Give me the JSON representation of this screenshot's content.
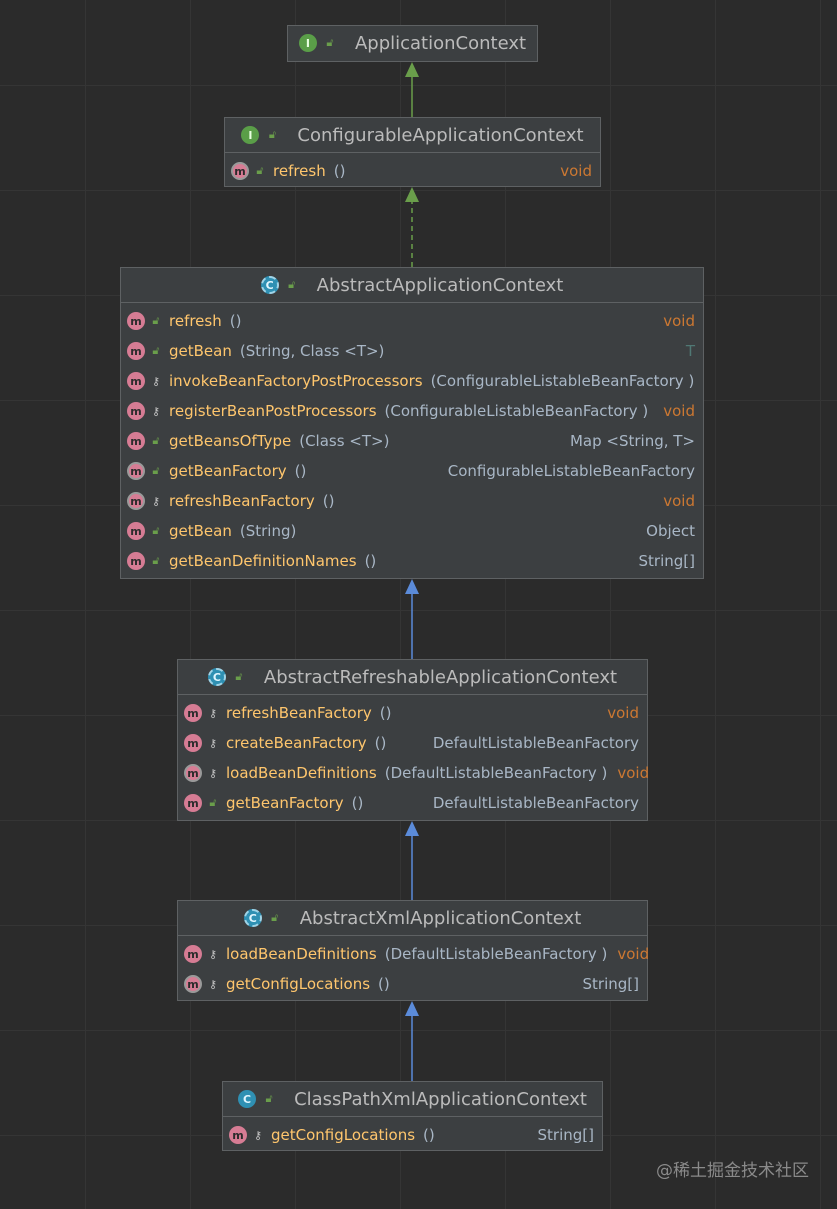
{
  "classes": [
    {
      "name": "ApplicationContext",
      "kind": "I",
      "members": []
    },
    {
      "name": "ConfigurableApplicationContext",
      "kind": "I",
      "members": [
        {
          "name": "refresh",
          "params": "()",
          "ret": "void",
          "ret_style": "kw",
          "vis": "public",
          "abstract": true
        }
      ]
    },
    {
      "name": "AbstractApplicationContext",
      "kind": "C",
      "abstract": true,
      "members": [
        {
          "name": "refresh",
          "params": "()",
          "ret": "void",
          "ret_style": "kw",
          "vis": "public",
          "abstract": false
        },
        {
          "name": "getBean",
          "params": "(String, Class <T>)",
          "ret": "T",
          "ret_style": "tp",
          "vis": "public",
          "abstract": false
        },
        {
          "name": "invokeBeanFactoryPostProcessors",
          "params": "(ConfigurableListableBeanFactory )",
          "ret": "",
          "ret_style": "",
          "vis": "protected",
          "abstract": false
        },
        {
          "name": "registerBeanPostProcessors",
          "params": "(ConfigurableListableBeanFactory )",
          "ret": "void",
          "ret_style": "kw",
          "vis": "protected",
          "abstract": false
        },
        {
          "name": "getBeansOfType",
          "params": "(Class <T>)",
          "ret": "Map <String, T>",
          "ret_style": "",
          "vis": "public",
          "abstract": false
        },
        {
          "name": "getBeanFactory",
          "params": "()",
          "ret": "ConfigurableListableBeanFactory",
          "ret_style": "",
          "vis": "public",
          "abstract": true
        },
        {
          "name": "refreshBeanFactory",
          "params": "()",
          "ret": "void",
          "ret_style": "kw",
          "vis": "protected",
          "abstract": true
        },
        {
          "name": "getBean",
          "params": "(String)",
          "ret": "Object",
          "ret_style": "",
          "vis": "public",
          "abstract": false
        },
        {
          "name": "getBeanDefinitionNames",
          "params": "()",
          "ret": "String[]",
          "ret_style": "",
          "vis": "public",
          "abstract": false
        }
      ]
    },
    {
      "name": "AbstractRefreshableApplicationContext",
      "kind": "C",
      "abstract": true,
      "members": [
        {
          "name": "refreshBeanFactory",
          "params": "()",
          "ret": "void",
          "ret_style": "kw",
          "vis": "protected",
          "abstract": false
        },
        {
          "name": "createBeanFactory",
          "params": "()",
          "ret": "DefaultListableBeanFactory",
          "ret_style": "",
          "vis": "protected",
          "abstract": false
        },
        {
          "name": "loadBeanDefinitions",
          "params": "(DefaultListableBeanFactory )",
          "ret": "void",
          "ret_style": "kw",
          "vis": "protected",
          "abstract": true
        },
        {
          "name": "getBeanFactory",
          "params": "()",
          "ret": "DefaultListableBeanFactory",
          "ret_style": "",
          "vis": "public",
          "abstract": false
        }
      ]
    },
    {
      "name": "AbstractXmlApplicationContext",
      "kind": "C",
      "abstract": true,
      "members": [
        {
          "name": "loadBeanDefinitions",
          "params": "(DefaultListableBeanFactory )",
          "ret": "void",
          "ret_style": "kw",
          "vis": "protected",
          "abstract": false
        },
        {
          "name": "getConfigLocations",
          "params": "()",
          "ret": "String[]",
          "ret_style": "",
          "vis": "protected",
          "abstract": true
        }
      ]
    },
    {
      "name": "ClassPathXmlApplicationContext",
      "kind": "C",
      "abstract": false,
      "members": [
        {
          "name": "getConfigLocations",
          "params": "()",
          "ret": "String[]",
          "ret_style": "",
          "vis": "protected",
          "abstract": false
        }
      ]
    }
  ],
  "edges": [
    {
      "from": 1,
      "to": 0,
      "style": "solid",
      "color": "#6a9e4b"
    },
    {
      "from": 2,
      "to": 1,
      "style": "dashed",
      "color": "#6a9e4b"
    },
    {
      "from": 3,
      "to": 2,
      "style": "solid",
      "color": "#5b8bd9"
    },
    {
      "from": 4,
      "to": 3,
      "style": "solid",
      "color": "#5b8bd9"
    },
    {
      "from": 5,
      "to": 4,
      "style": "solid",
      "color": "#5b8bd9"
    }
  ],
  "watermark": "@稀土掘金技术社区"
}
